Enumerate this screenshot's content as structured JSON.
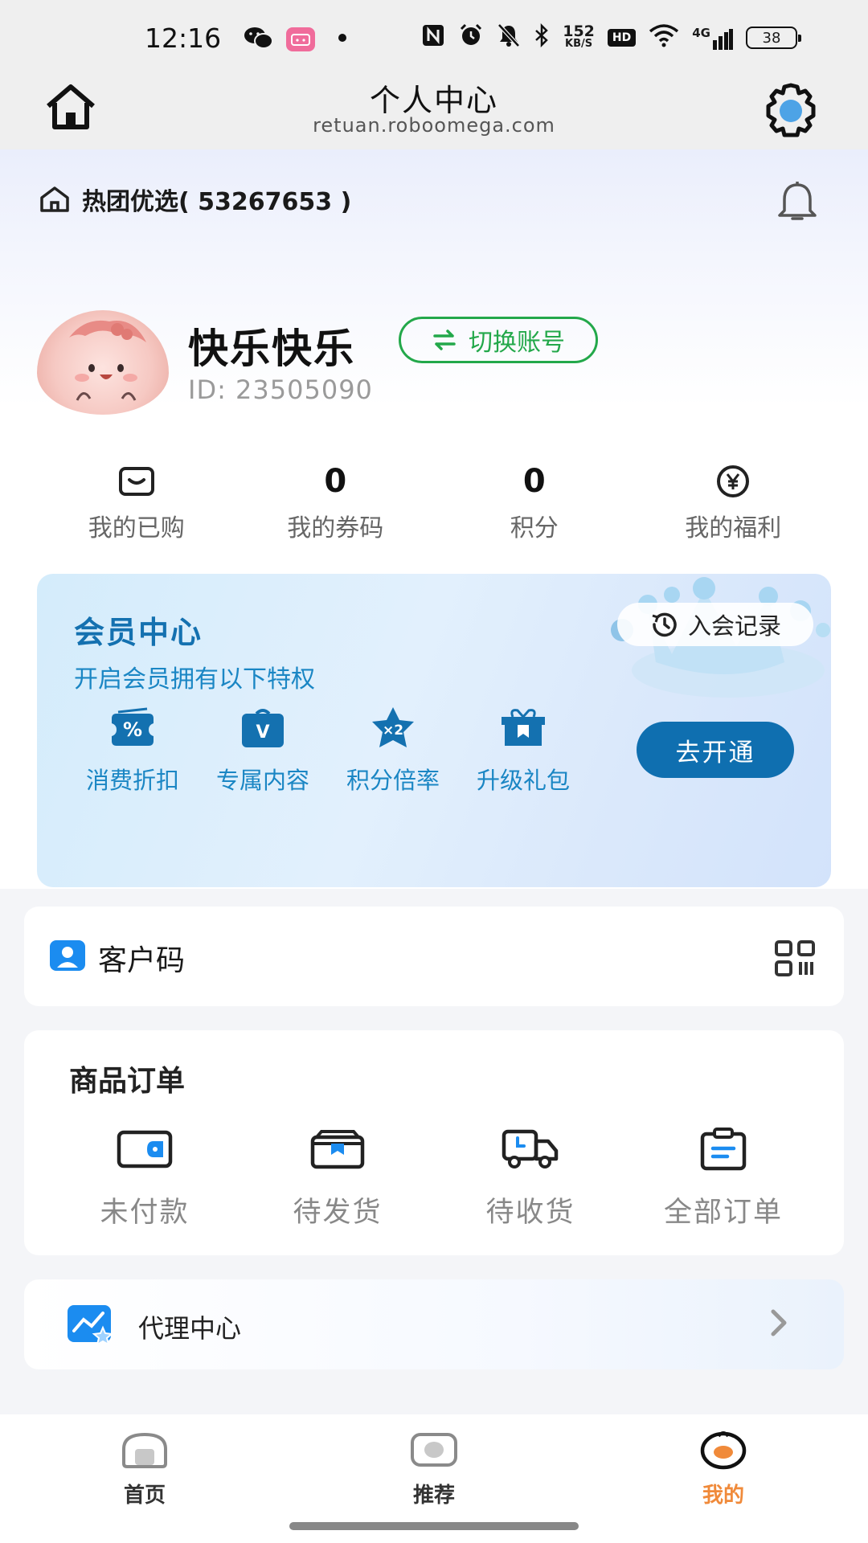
{
  "status_bar": {
    "time": "12:16",
    "network_speed_value": "152",
    "network_speed_unit": "KB/S",
    "hd_label": "HD",
    "signal_label": "4G",
    "battery_level": "38"
  },
  "titlebar": {
    "title": "个人中心",
    "subtitle": "retuan.roboomega.com"
  },
  "store": {
    "name": "热团优选( 53267653 )"
  },
  "profile": {
    "nickname": "快乐快乐",
    "switch_account_label": "切换账号",
    "id_text": "ID: 23505090"
  },
  "stats": [
    {
      "value": "",
      "icon": "wallet-icon",
      "label": "我的已购"
    },
    {
      "value": "0",
      "label": "我的券码"
    },
    {
      "value": "0",
      "label": "积分"
    },
    {
      "value": "",
      "icon": "yen-coin-icon",
      "label": "我的福利"
    }
  ],
  "member": {
    "title": "会员中心",
    "subtitle": "开启会员拥有以下特权",
    "perks": [
      {
        "label": "消费折扣",
        "icon": "discount-icon",
        "icon_text": "%"
      },
      {
        "label": "专属内容",
        "icon": "exclusive-content-icon",
        "icon_text": "V"
      },
      {
        "label": "积分倍率",
        "icon": "points-multiplier-icon",
        "icon_text": "×2"
      },
      {
        "label": "升级礼包",
        "icon": "gift-package-icon",
        "icon_text": ""
      }
    ],
    "record_label": "入会记录",
    "open_label": "去开通"
  },
  "customer_code": {
    "label": "客户码"
  },
  "orders": {
    "title": "商品订单",
    "items": [
      {
        "label": "未付款",
        "icon": "wallet-icon"
      },
      {
        "label": "待发货",
        "icon": "package-box-icon"
      },
      {
        "label": "待收货",
        "icon": "delivery-truck-icon"
      },
      {
        "label": "全部订单",
        "icon": "clipboard-icon"
      }
    ]
  },
  "agent": {
    "label": "代理中心"
  },
  "bottom_nav": {
    "items": [
      {
        "label": "首页",
        "active": false
      },
      {
        "label": "推荐",
        "active": false
      },
      {
        "label": "我的",
        "active": true
      }
    ]
  },
  "colors": {
    "accent_green": "#23a84a",
    "member_blue": "#1471b0",
    "member_button": "#0f6fb0",
    "nav_active": "#f08a3a"
  }
}
